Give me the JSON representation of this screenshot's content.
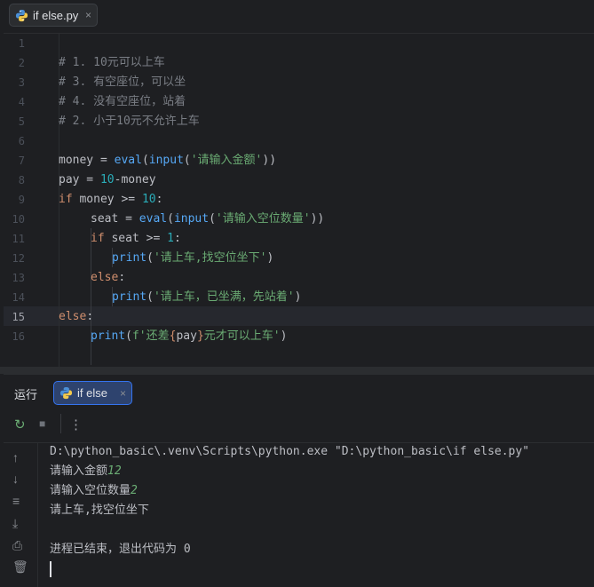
{
  "editor": {
    "tab": {
      "label": "if else.py",
      "close": "×"
    },
    "line_numbers": [
      "1",
      "2",
      "3",
      "4",
      "5",
      "6",
      "7",
      "8",
      "9",
      "10",
      "11",
      "12",
      "13",
      "14",
      "15",
      "16"
    ],
    "active_line": "15",
    "lines": {
      "l2": "# 1. 10元可以上车",
      "l3": "# 3. 有空座位，可以坐",
      "l4": "# 4. 没有空座位，站着",
      "l5": "# 2. 小于10元不允许上车",
      "l7": {
        "a": "money = ",
        "b": "eval",
        "c": "(",
        "d": "input",
        "e": "(",
        "f": "'请输入金额'",
        "g": "))"
      },
      "l8": {
        "a": "pay = ",
        "b": "10",
        "c": "-money"
      },
      "l9": {
        "a": "if",
        "b": " money >= ",
        "c": "10",
        "d": ":"
      },
      "l10": {
        "a": "seat = ",
        "b": "eval",
        "c": "(",
        "d": "input",
        "e": "(",
        "f": "'请输入空位数量'",
        "g": "))"
      },
      "l11": {
        "a": "if",
        "b": " seat >= ",
        "c": "1",
        "d": ":"
      },
      "l12": {
        "a": "print",
        "b": "(",
        "c": "'请上车,找空位坐下'",
        "d": ")"
      },
      "l13": {
        "a": "else",
        "b": ":"
      },
      "l14": {
        "a": "print",
        "b": "(",
        "c": "'请上车，已坐满，先站着'",
        "d": ")"
      },
      "l15": {
        "a": "else",
        "b": ":"
      },
      "l16": {
        "a": "print",
        "b": "(",
        "c": "f'还差",
        "d": "{",
        "e": "pay",
        "f": "}",
        "g": "元才可以上车'",
        "h": ")"
      }
    }
  },
  "run": {
    "title": "运行",
    "tab": {
      "label": "if else",
      "close": "×"
    },
    "console": {
      "cmd": "D:\\python_basic\\.venv\\Scripts\\python.exe \"D:\\python_basic\\if else.py\"",
      "p1": "请输入金额",
      "i1": "12",
      "p2": "请输入空位数量",
      "i2": "2",
      "out1": "请上车,找空位坐下",
      "exit": "进程已结束，退出代码为 0"
    }
  },
  "icons": {
    "python_file": "python-logo-icon",
    "rerun": "↻",
    "stop": "■",
    "more": "⋮",
    "up": "↑",
    "down": "↓",
    "wrap": "≡",
    "scroll_end": "⤓",
    "print": "⎙",
    "trash": "🗑"
  },
  "colors": {
    "accent": "#3574f0",
    "keyword": "#cf8e6d",
    "function": "#56a8f5",
    "string": "#6aab73",
    "number": "#2aacb8",
    "comment": "#7a7e85"
  }
}
